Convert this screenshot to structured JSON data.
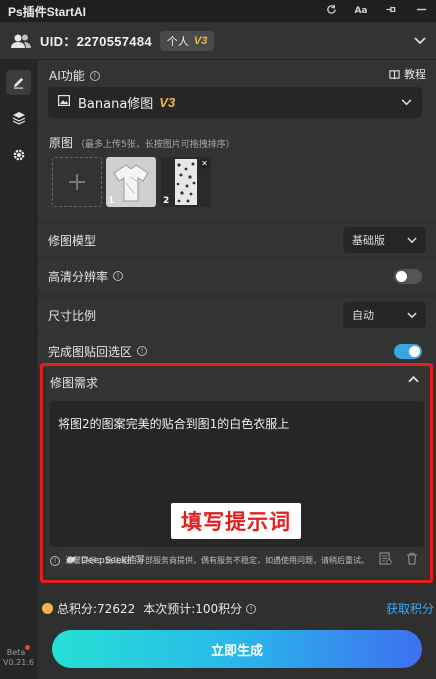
{
  "app": {
    "title": "Ps插件StartAI"
  },
  "titlebar": {
    "tools": [
      "refresh-icon",
      "font-size-icon",
      "pin-icon",
      "minimize-icon"
    ],
    "font_label": "Aa"
  },
  "account": {
    "uid_label": "UID：2270557484",
    "plan": "个人",
    "plan_version": "V3"
  },
  "ai_function": {
    "label": "AI功能",
    "tutorial": "教程",
    "selected": "Banana修图",
    "selected_version": "V3"
  },
  "source_images": {
    "label": "原图",
    "hint": "（最多上传5张，长按图片可拖拽排序）",
    "items": [
      {
        "index": "1"
      },
      {
        "index": "2"
      }
    ]
  },
  "retouch_model": {
    "label": "修图模型",
    "value": "基础版"
  },
  "hd_resolution": {
    "label": "高清分辨率",
    "enabled": false
  },
  "aspect_ratio": {
    "label": "尺寸比例",
    "value": "自动"
  },
  "paste_back": {
    "label": "完成图贴回选区",
    "enabled": true
  },
  "request": {
    "label": "修图需求",
    "text": "将图2的图案完美的贴合到图1的白色衣服上",
    "stamp": "填写提示词",
    "deepseek": "DeepSeek扩写",
    "notice": "温馨提示：此功能由外部服务商提供，偶有服务不稳定，如遇使用问题，请稍后重试。"
  },
  "footer": {
    "total_points": "总积分:72622",
    "estimate": "本次预计:100积分",
    "get_points": "获取积分",
    "generate": "立即生成"
  },
  "version": {
    "beta": "Beta",
    "number": "V0.21.6"
  },
  "colors": {
    "accent": "#3aa5e6",
    "danger": "#e11f1f",
    "gold": "#f0b84a",
    "gradient_start": "#26e0d4",
    "gradient_end": "#3e6ff0"
  }
}
